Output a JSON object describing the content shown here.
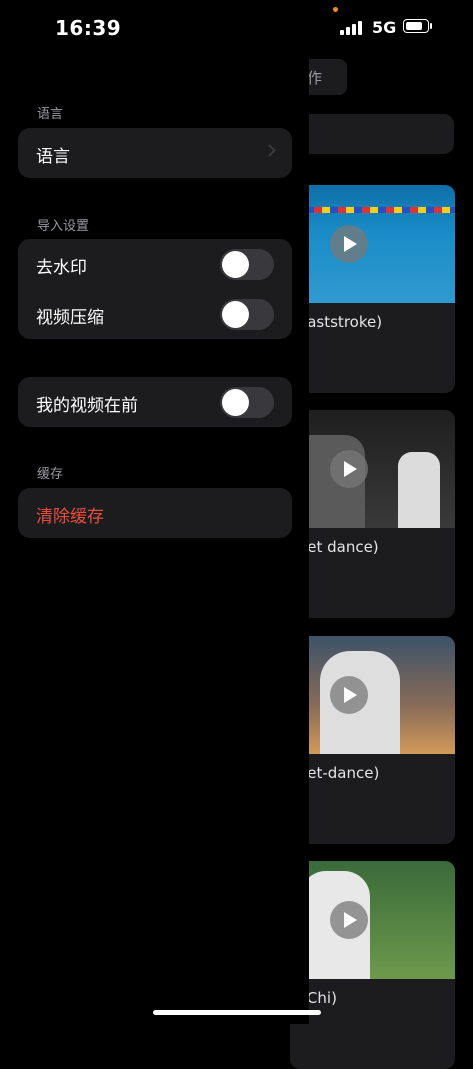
{
  "status_bar": {
    "time": "16:39",
    "network": "5G"
  },
  "background": {
    "tab_fragment": "作",
    "videos": [
      {
        "title": "eaststroke)"
      },
      {
        "title": "eet dance)"
      },
      {
        "title": "eet-dance)"
      },
      {
        "title": "i Chi)"
      }
    ]
  },
  "drawer": {
    "language_section": "语言",
    "language_row": "语言",
    "import_section": "导入设置",
    "remove_watermark": "去水印",
    "compress_video": "视频压缩",
    "my_video_first": "我的视频在前",
    "cache_section": "缓存",
    "clear_cache": "清除缓存",
    "toggles": {
      "remove_watermark": false,
      "compress_video": false,
      "my_video_first": false
    }
  }
}
